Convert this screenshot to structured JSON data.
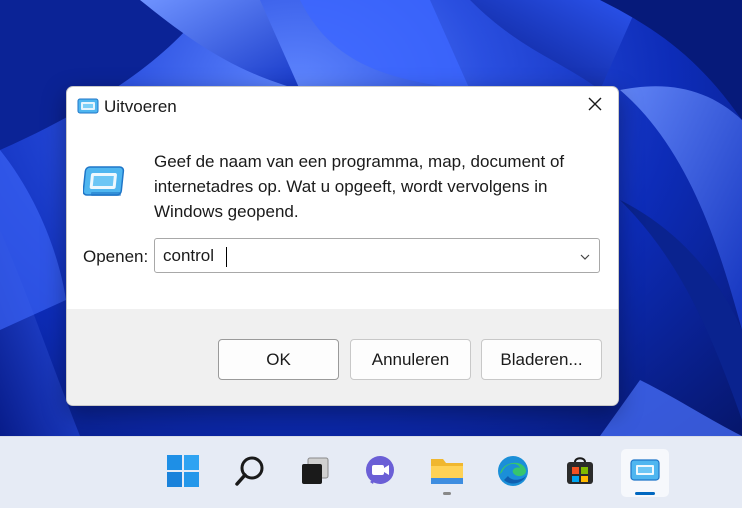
{
  "dialog": {
    "title": "Uitvoeren",
    "description": "Geef de naam van een programma, map, document of internetadres op. Wat u opgeeft, wordt vervolgens in Windows geopend.",
    "open_label": "Openen:",
    "input_value": "control",
    "buttons": {
      "ok": "OK",
      "cancel": "Annuleren",
      "browse": "Bladeren..."
    }
  },
  "taskbar": {
    "items": [
      "start-icon",
      "search-icon",
      "task-view-icon",
      "teams-chat-icon",
      "file-explorer-icon",
      "edge-icon",
      "store-icon",
      "run-icon"
    ],
    "active_item": "run-icon"
  },
  "colors": {
    "accent": "#0067c0",
    "wallpaper": "#1d45d8",
    "taskbar": "#e6ebf5"
  }
}
